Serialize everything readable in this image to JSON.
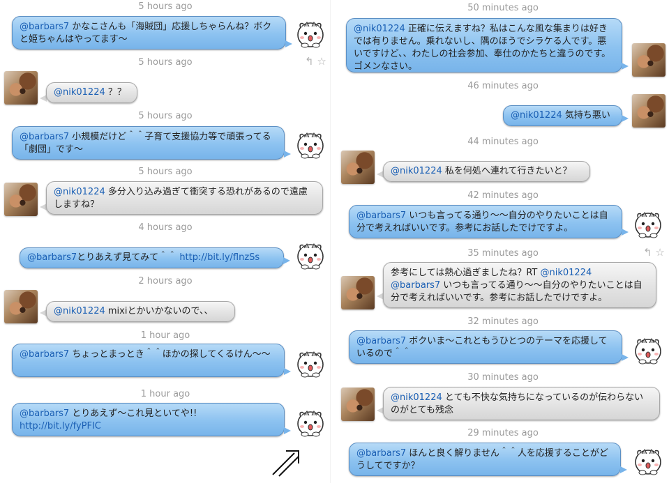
{
  "left": {
    "timestamps": [
      "5 hours ago",
      "5 hours ago",
      "5 hours ago",
      "5 hours ago",
      "4 hours ago",
      "2 hours ago",
      "1 hour ago",
      "1 hour ago"
    ],
    "messages": [
      {
        "mention": "@barbars7",
        "text": " かなこさんも「海賊団」応援しちゃらんね？ボクと姫ちゃんはやってます〜",
        "sender": "hamster"
      },
      {
        "mention": "@nik01224",
        "text": " ？？",
        "sender": "dog"
      },
      {
        "mention": "@barbars7",
        "text": " 小規模だけど＾＾子育て支援協力等で頑張ってる「劇団」です〜",
        "sender": "hamster"
      },
      {
        "mention": "@nik01224",
        "text": " 多分入り込み過ぎて衝突する恐れがあるので遠慮しますね？",
        "sender": "dog"
      },
      {
        "mention": "@barbars7",
        "text": "とりあえず見てみて＾＾ ",
        "link": "http://bit.ly/flnzSs",
        "sender": "hamster"
      },
      {
        "mention": "@nik01224",
        "text": " mixiとかいかないので、、",
        "sender": "dog"
      },
      {
        "mention": "@barbars7",
        "text": " ちょっとまっとき＾＾ほかの探してくるけん〜〜",
        "sender": "hamster"
      },
      {
        "mention": "@barbars7",
        "text": " とりあえず〜これ見といてや!!  ",
        "link": "http://bit.ly/fyPFIC",
        "sender": "hamster"
      }
    ]
  },
  "right": {
    "timestamps": [
      "50 minutes ago",
      "46 minutes ago",
      "44 minutes ago",
      "42 minutes ago",
      "35 minutes ago",
      "32 minutes ago",
      "30 minutes ago",
      "29 minutes ago"
    ],
    "messages": [
      {
        "mention": "@nik01224",
        "text": " 正確に伝えますね？私はこんな風な集まりは好きでは有りません。乗れないし、隅のほうでシラケる人です。悪いですけど、、わたしの社会参加、奉仕のかたちと違うのです。ゴメンなさい。",
        "sender": "dog"
      },
      {
        "mention": "@nik01224",
        "text": " 気持ち悪い",
        "sender": "dog"
      },
      {
        "mention": "@nik01224",
        "text": " 私を何処へ連れて行きたいと？",
        "sender": "dog"
      },
      {
        "mention": "@barbars7",
        "text": " いつも言ってる通り〜〜自分のやりたいことは自分で考えればいいです。参考にお話したでけですよ。",
        "sender": "hamster"
      },
      {
        "prefix": "参考にしては熱心過ぎましたね？RT ",
        "mention": "@nik01224",
        "mention2": "@barbars7",
        "text": " いつも言ってる通り〜〜自分のやりたいことは自分で考えればいいです。参考にお話したでけですよ。",
        "sender": "dog"
      },
      {
        "mention": "@barbars7",
        "text": " ボクいま〜これともうひとつのテーマを応援しているので＾＾",
        "sender": "hamster"
      },
      {
        "mention": "@nik01224",
        "text": " とても不快な気持ちになっているのが伝わらないのがとても残念",
        "sender": "dog"
      },
      {
        "mention": "@barbars7",
        "text": " ほんと良く解りません＾＾人を応援することがどうしてですか？",
        "sender": "hamster"
      }
    ]
  },
  "icons": {
    "reply": "reply-icon",
    "favorite": "star-icon",
    "annotation": "double-arrow-icon",
    "reply_glyph": "↰",
    "favorite_glyph": "☆"
  },
  "colors": {
    "mention": "#1a5fb4",
    "bubble_blue": "#8cc2f0",
    "bubble_gray": "#e3e3e3",
    "timestamp": "#9a9a9a"
  }
}
